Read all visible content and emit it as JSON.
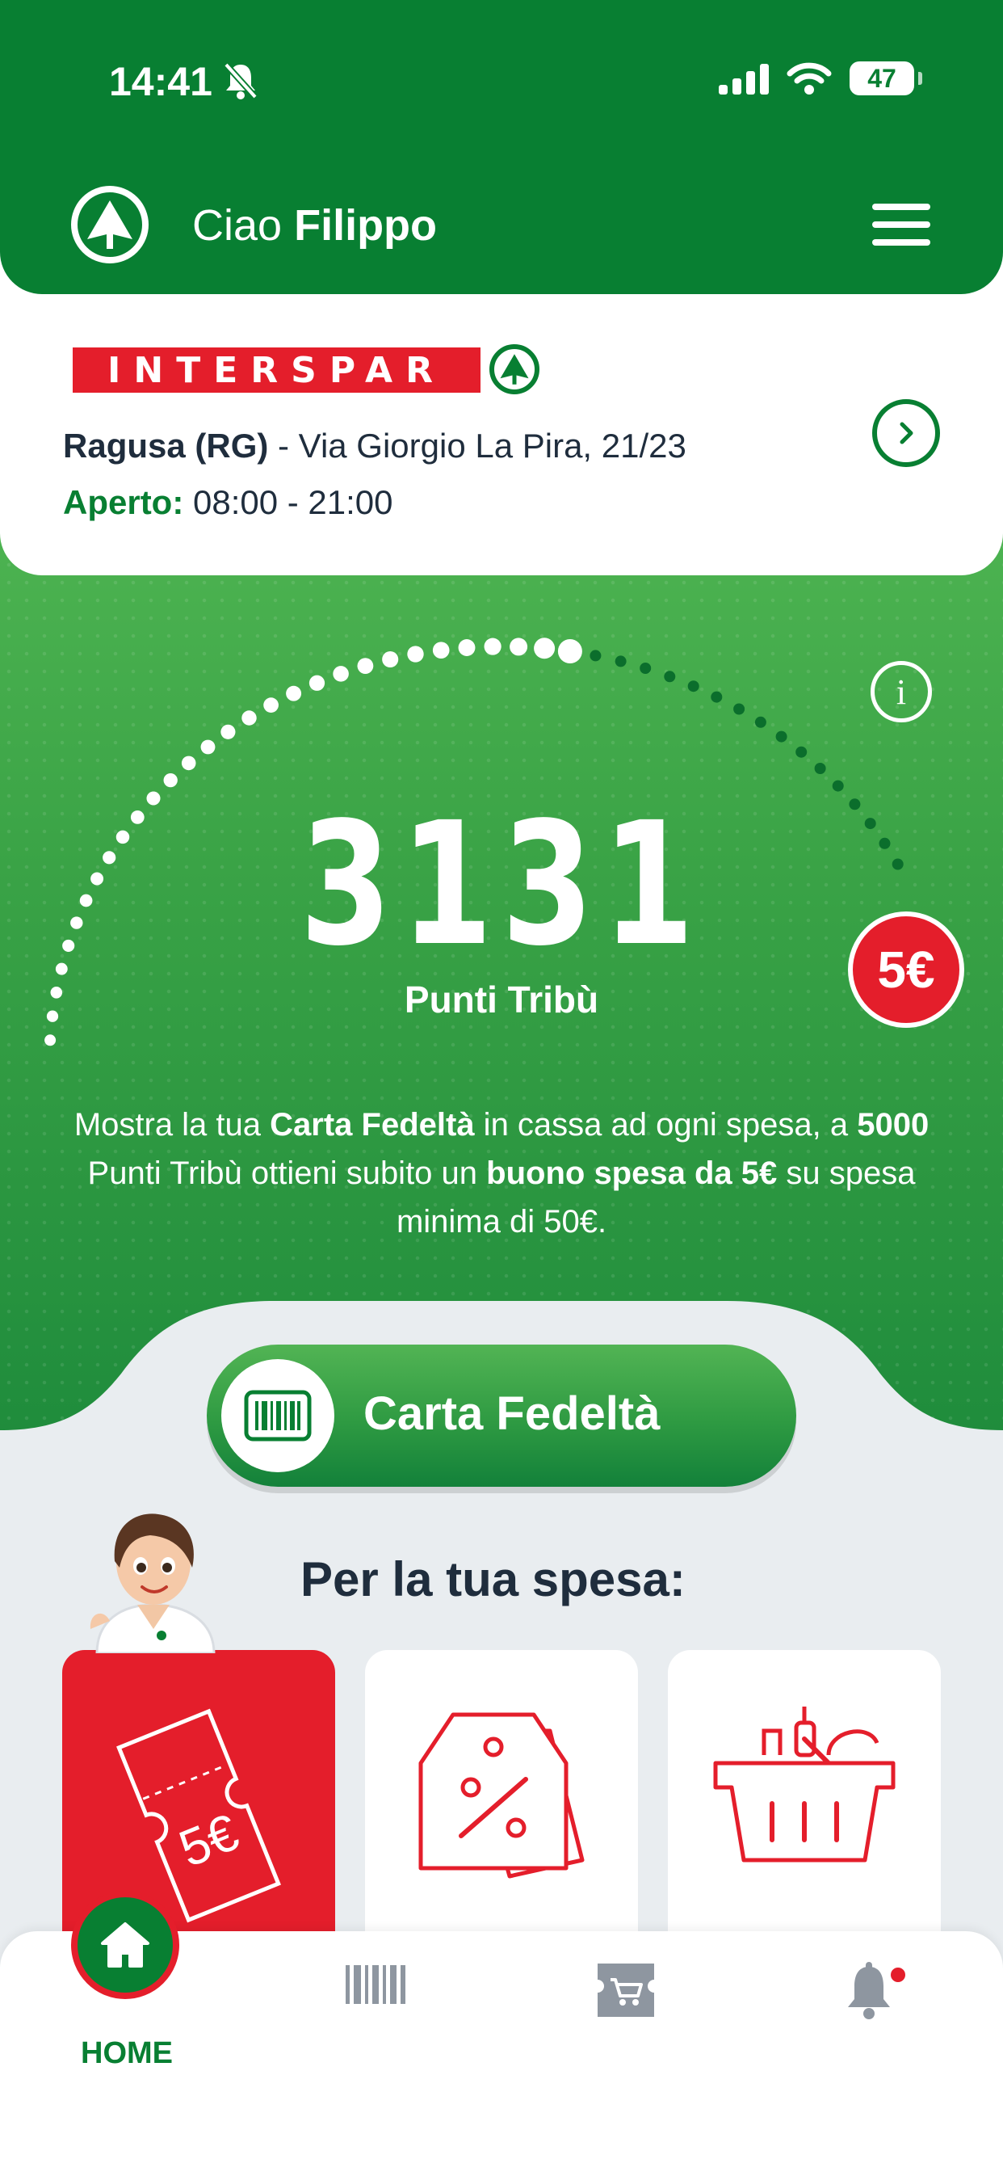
{
  "status_bar": {
    "time": "14:41",
    "battery": "47"
  },
  "header": {
    "greeting_prefix": "Ciao",
    "user_name": "Filippo"
  },
  "store": {
    "brand": "INTERSPAR",
    "city": "Ragusa (RG)",
    "address": " - Via Giorgio La Pira, 21/23",
    "hours_label": "Aperto:",
    "hours_value": " 08:00 - 21:00"
  },
  "points": {
    "value": "3131",
    "label": "Punti Tribù",
    "reward_badge": "5€",
    "progress_fraction": 0.63
  },
  "promo": {
    "p1": "Mostra la tua ",
    "b1": "Carta Fedeltà",
    "p2": " in cassa ad ogni spesa, a ",
    "b2": "5000",
    "p3": " Punti Tribù ottieni subito un ",
    "b3": "buono spesa da 5€",
    "p4": " su spesa minima di 50€."
  },
  "card_button": {
    "label": "Carta Fedeltà"
  },
  "section": {
    "title": "Per la tua spesa:"
  },
  "tiles": [
    {
      "icon": "voucher-icon",
      "text": "5€"
    },
    {
      "icon": "discount-tags-icon"
    },
    {
      "icon": "shopping-basket-icon"
    }
  ],
  "bottom_nav": {
    "home_label": "HOME",
    "items": [
      "home-icon",
      "barcode-icon",
      "cart-icon",
      "bell-icon"
    ]
  },
  "colors": {
    "brand_green": "#087f32",
    "brand_red": "#e41e2b",
    "background": "#e9edf0"
  }
}
